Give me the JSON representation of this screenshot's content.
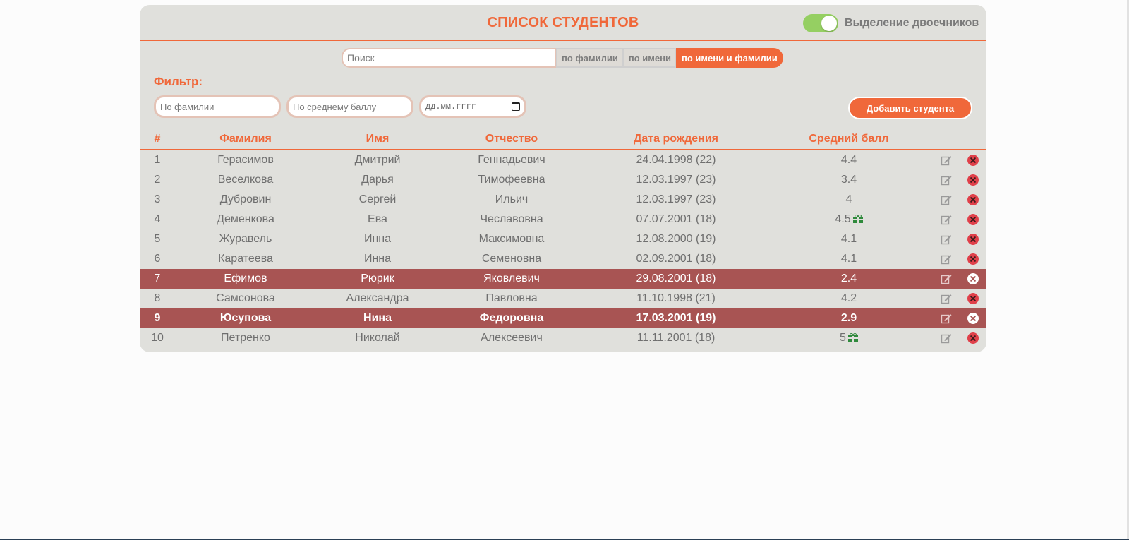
{
  "header": {
    "title": "СПИСОК СТУДЕНТОВ",
    "toggle_label": "Выделение двоечников",
    "toggle_on": true
  },
  "search": {
    "placeholder": "Поиск",
    "value": "",
    "modes": [
      {
        "label": "по фамилии",
        "active": false
      },
      {
        "label": "по имени",
        "active": false
      },
      {
        "label": "по имени и фамилии",
        "active": true
      }
    ]
  },
  "filter": {
    "label": "Фильтр:",
    "lastname_placeholder": "По фамилии",
    "avg_placeholder": "По среднему баллу",
    "date_placeholder": "дд.мм.гггг"
  },
  "add_button": "Добавить студента",
  "table": {
    "columns": [
      "#",
      "Фамилия",
      "Имя",
      "Отчество",
      "Дата рождения",
      "Средний балл"
    ],
    "rows": [
      {
        "num": "1",
        "last": "Герасимов",
        "first": "Дмитрий",
        "patronymic": "Геннадьевич",
        "dob": "24.04.1998 (22)",
        "avg": "4.4",
        "gift": false,
        "highlight": false,
        "bold": false
      },
      {
        "num": "2",
        "last": "Веселкова",
        "first": "Дарья",
        "patronymic": "Тимофеевна",
        "dob": "12.03.1997 (23)",
        "avg": "3.4",
        "gift": false,
        "highlight": false,
        "bold": false
      },
      {
        "num": "3",
        "last": "Дубровин",
        "first": "Сергей",
        "patronymic": "Ильич",
        "dob": "12.03.1997 (23)",
        "avg": "4",
        "gift": false,
        "highlight": false,
        "bold": false
      },
      {
        "num": "4",
        "last": "Деменкова",
        "first": "Ева",
        "patronymic": "Чеславовна",
        "dob": "07.07.2001 (18)",
        "avg": "4.5",
        "gift": true,
        "highlight": false,
        "bold": false
      },
      {
        "num": "5",
        "last": "Журавель",
        "first": "Инна",
        "patronymic": "Максимовна",
        "dob": "12.08.2000 (19)",
        "avg": "4.1",
        "gift": false,
        "highlight": false,
        "bold": false
      },
      {
        "num": "6",
        "last": "Каратеева",
        "first": "Инна",
        "patronymic": "Семеновна",
        "dob": "02.09.2001 (18)",
        "avg": "4.1",
        "gift": false,
        "highlight": false,
        "bold": false
      },
      {
        "num": "7",
        "last": "Ефимов",
        "first": "Рюрик",
        "patronymic": "Яковлевич",
        "dob": "29.08.2001 (18)",
        "avg": "2.4",
        "gift": false,
        "highlight": true,
        "bold": false
      },
      {
        "num": "8",
        "last": "Самсонова",
        "first": "Александра",
        "patronymic": "Павловна",
        "dob": "11.10.1998 (21)",
        "avg": "4.2",
        "gift": false,
        "highlight": false,
        "bold": false
      },
      {
        "num": "9",
        "last": "Юсупова",
        "first": "Нина",
        "patronymic": "Федоровна",
        "dob": "17.03.2001 (19)",
        "avg": "2.9",
        "gift": false,
        "highlight": true,
        "bold": true
      },
      {
        "num": "10",
        "last": "Петренко",
        "first": "Николай",
        "patronymic": "Алексеевич",
        "dob": "11.11.2001 (18)",
        "avg": "5",
        "gift": true,
        "highlight": false,
        "bold": false
      }
    ]
  },
  "icons": {
    "edit": "edit-icon",
    "delete": "delete-icon",
    "gift": "gift-icon",
    "calendar": "calendar-icon"
  },
  "colors": {
    "accent": "#f0683a",
    "panel": "#e0e0dc",
    "failing_row": "#a85453",
    "toggle_on": "#95cf62",
    "gift": "#2f8a3c",
    "delete": "#e0404a"
  }
}
